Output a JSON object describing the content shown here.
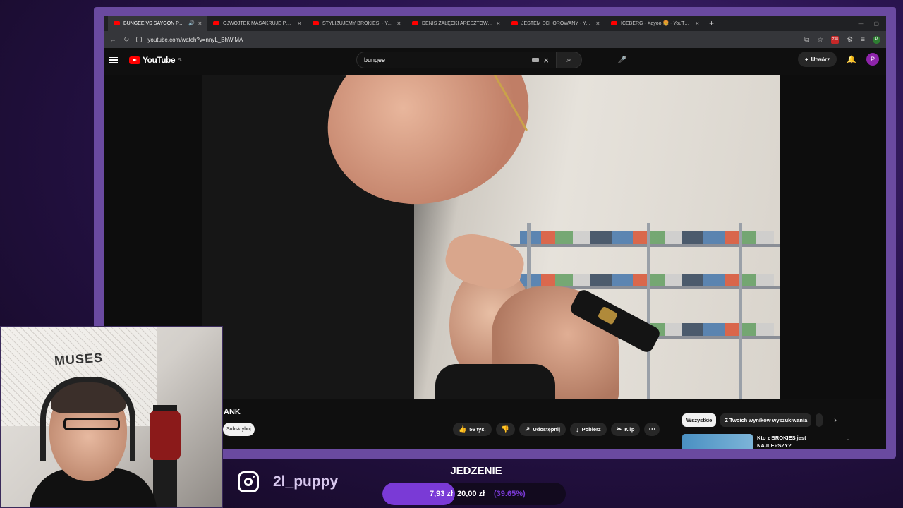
{
  "browser": {
    "tabs": [
      {
        "title": "BUNGEE VS SAYGON PRANK",
        "active": true,
        "audio": true
      },
      {
        "title": "OJWOJTEK MASAKRUJE POLSKI",
        "active": false
      },
      {
        "title": "STYLIZUJEMY BROKIESI - YouTube",
        "active": false
      },
      {
        "title": "DENIS ZAŁĘCKI ARESZTOWANY",
        "active": false
      },
      {
        "title": "JESTEM SCHOROWANY - YouTube",
        "active": false
      },
      {
        "title": "ICEBERG - Xayoo 🍔 - YouTube",
        "active": false
      }
    ],
    "url": "youtube.com/watch?v=nnyL_BhWiMA",
    "extension_badge": "238",
    "profile_initial": "P"
  },
  "youtube": {
    "logo_text": "YouTube",
    "logo_region": "PL",
    "search_value": "bungee",
    "create_label": "Utwórz",
    "avatar_initial": "P",
    "video_title": "ANK",
    "subscribe_label": "Subskrybuj",
    "actions": {
      "likes": "56 tys.",
      "share": "Udostępnij",
      "download": "Pobierz",
      "clip": "Klip"
    },
    "chips": [
      "Wszystkie",
      "Z Twoich wyników wyszukiwania"
    ],
    "recommended_title": "Kto z BROKIES jest NAJLEPSZY?"
  },
  "overlay": {
    "instagram_handle": "2l_puppy",
    "goal_title": "JEDZENIE",
    "goal_current": "7,93 zł",
    "goal_target": "20,00 zł",
    "goal_percent_label": "(39.65%)",
    "goal_fraction": 0.3965,
    "accent": "#7a3ad6"
  }
}
